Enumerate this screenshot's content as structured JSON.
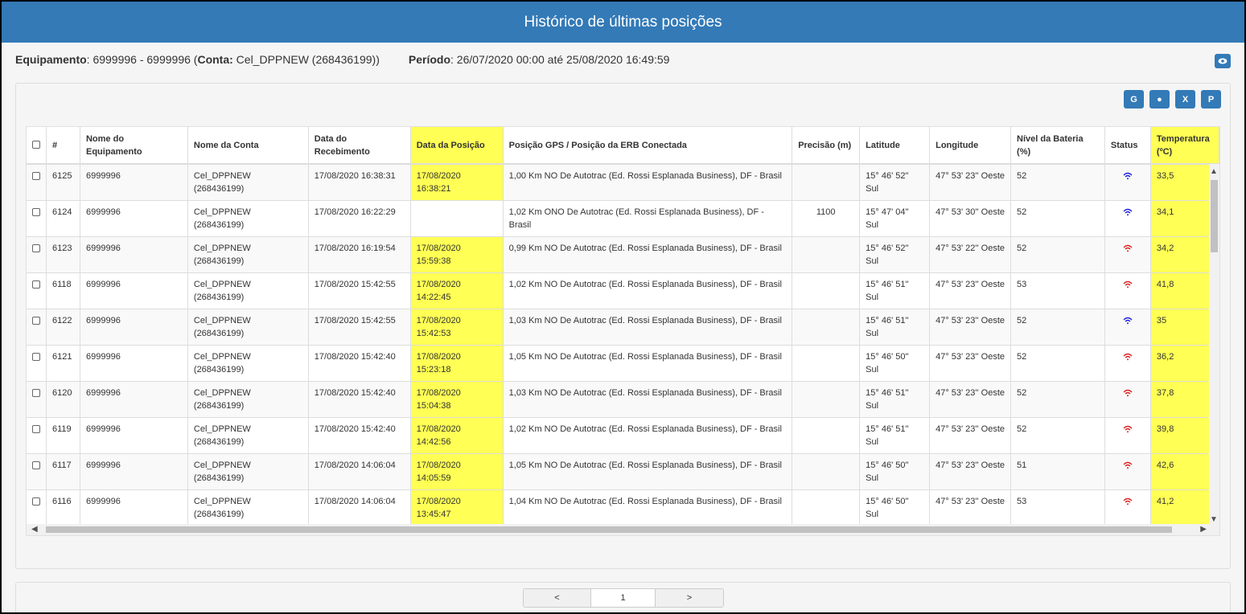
{
  "header": {
    "title": "Histórico de últimas posições"
  },
  "info": {
    "equip_label": "Equipamento",
    "equip_value": ": 6999996 - 6999996 (",
    "conta_label": "Conta:",
    "conta_value": " Cel_DPPNEW (268436199))",
    "periodo_label": "Período",
    "periodo_value": ": 26/07/2020 00:00 até 25/08/2020 16:49:59"
  },
  "toolbar": {
    "buttons": [
      {
        "icon": "google-icon",
        "glyph": "G"
      },
      {
        "icon": "globe-icon",
        "glyph": "●"
      },
      {
        "icon": "excel-file-icon",
        "glyph": "X"
      },
      {
        "icon": "pdf-file-icon",
        "glyph": "P"
      }
    ]
  },
  "table": {
    "columns": [
      "#",
      "Nome do Equipamento",
      "Nome da Conta",
      "Data do Recebimento",
      "Data da Posição",
      "Posição GPS / Posição da ERB Conectada",
      "Precisão (m)",
      "Latitude",
      "Longitude",
      "Nível da Bateria (%)",
      "Status",
      "Temperatura (ºC)"
    ],
    "rows": [
      {
        "id": "6125",
        "equip": "6999996",
        "conta": "Cel_DPPNEW (268436199)",
        "receb": "17/08/2020 16:38:31",
        "posdata": "17/08/2020 16:38:21",
        "pos": "1,00 Km NO De Autotrac (Ed. Rossi Esplanada Business), DF - Brasil",
        "prec": "",
        "lat": "15° 46' 52'' Sul",
        "lon": "47° 53' 23'' Oeste",
        "bat": "52",
        "status": "blue",
        "temp": "33,5"
      },
      {
        "id": "6124",
        "equip": "6999996",
        "conta": "Cel_DPPNEW (268436199)",
        "receb": "17/08/2020 16:22:29",
        "posdata": "",
        "pos": "1,02 Km ONO De Autotrac (Ed. Rossi Esplanada Business), DF - Brasil",
        "prec": "1100",
        "lat": "15° 47' 04'' Sul",
        "lon": "47° 53' 30'' Oeste",
        "bat": "52",
        "status": "blue",
        "temp": "34,1"
      },
      {
        "id": "6123",
        "equip": "6999996",
        "conta": "Cel_DPPNEW (268436199)",
        "receb": "17/08/2020 16:19:54",
        "posdata": "17/08/2020 15:59:38",
        "pos": "0,99 Km NO De Autotrac (Ed. Rossi Esplanada Business), DF - Brasil",
        "prec": "",
        "lat": "15° 46' 52'' Sul",
        "lon": "47° 53' 22'' Oeste",
        "bat": "52",
        "status": "red",
        "temp": "34,2"
      },
      {
        "id": "6118",
        "equip": "6999996",
        "conta": "Cel_DPPNEW (268436199)",
        "receb": "17/08/2020 15:42:55",
        "posdata": "17/08/2020 14:22:45",
        "pos": "1,02 Km NO De Autotrac (Ed. Rossi Esplanada Business), DF - Brasil",
        "prec": "",
        "lat": "15° 46' 51'' Sul",
        "lon": "47° 53' 23'' Oeste",
        "bat": "53",
        "status": "red",
        "temp": "41,8"
      },
      {
        "id": "6122",
        "equip": "6999996",
        "conta": "Cel_DPPNEW (268436199)",
        "receb": "17/08/2020 15:42:55",
        "posdata": "17/08/2020 15:42:53",
        "pos": "1,03 Km NO De Autotrac (Ed. Rossi Esplanada Business), DF - Brasil",
        "prec": "",
        "lat": "15° 46' 51'' Sul",
        "lon": "47° 53' 23'' Oeste",
        "bat": "52",
        "status": "blue",
        "temp": "35"
      },
      {
        "id": "6121",
        "equip": "6999996",
        "conta": "Cel_DPPNEW (268436199)",
        "receb": "17/08/2020 15:42:40",
        "posdata": "17/08/2020 15:23:18",
        "pos": "1,05 Km NO De Autotrac (Ed. Rossi Esplanada Business), DF - Brasil",
        "prec": "",
        "lat": "15° 46' 50'' Sul",
        "lon": "47° 53' 23'' Oeste",
        "bat": "52",
        "status": "red",
        "temp": "36,2"
      },
      {
        "id": "6120",
        "equip": "6999996",
        "conta": "Cel_DPPNEW (268436199)",
        "receb": "17/08/2020 15:42:40",
        "posdata": "17/08/2020 15:04:38",
        "pos": "1,03 Km NO De Autotrac (Ed. Rossi Esplanada Business), DF - Brasil",
        "prec": "",
        "lat": "15° 46' 51'' Sul",
        "lon": "47° 53' 23'' Oeste",
        "bat": "52",
        "status": "red",
        "temp": "37,8"
      },
      {
        "id": "6119",
        "equip": "6999996",
        "conta": "Cel_DPPNEW (268436199)",
        "receb": "17/08/2020 15:42:40",
        "posdata": "17/08/2020 14:42:56",
        "pos": "1,02 Km NO De Autotrac (Ed. Rossi Esplanada Business), DF - Brasil",
        "prec": "",
        "lat": "15° 46' 51'' Sul",
        "lon": "47° 53' 23'' Oeste",
        "bat": "52",
        "status": "red",
        "temp": "39,8"
      },
      {
        "id": "6117",
        "equip": "6999996",
        "conta": "Cel_DPPNEW (268436199)",
        "receb": "17/08/2020 14:06:04",
        "posdata": "17/08/2020 14:05:59",
        "pos": "1,05 Km NO De Autotrac (Ed. Rossi Esplanada Business), DF - Brasil",
        "prec": "",
        "lat": "15° 46' 50'' Sul",
        "lon": "47° 53' 23'' Oeste",
        "bat": "51",
        "status": "red",
        "temp": "42,6"
      },
      {
        "id": "6116",
        "equip": "6999996",
        "conta": "Cel_DPPNEW (268436199)",
        "receb": "17/08/2020 14:06:04",
        "posdata": "17/08/2020 13:45:47",
        "pos": "1,04 Km NO De Autotrac (Ed. Rossi Esplanada Business), DF - Brasil",
        "prec": "",
        "lat": "15° 46' 50'' Sul",
        "lon": "47° 53' 23'' Oeste",
        "bat": "53",
        "status": "red",
        "temp": "41,2"
      }
    ]
  },
  "pagination": {
    "prev": "<",
    "page": "1",
    "next": ">"
  },
  "colors": {
    "header_bg": "#337ab7",
    "highlight": "#ffff55",
    "status_online": "#2222dd",
    "status_offline": "#dd2222"
  }
}
